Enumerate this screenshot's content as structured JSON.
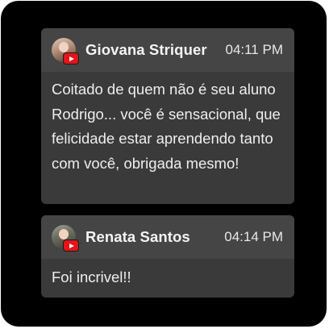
{
  "comments": [
    {
      "author": "Giovana Striquer",
      "time": "04:11 PM",
      "message": "Coitado de quem não é seu aluno Rodrigo... você é sensacional, que felicidade estar aprendendo tanto com você, obrigada mesmo!",
      "badge_icon": "youtube-icon"
    },
    {
      "author": "Renata Santos",
      "time": "04:14 PM",
      "message": "Foi incrivel!!",
      "badge_icon": "youtube-icon"
    }
  ],
  "colors": {
    "background": "#000000",
    "card": "#3a3a3a",
    "card_header": "#454545",
    "badge": "#e3141a",
    "text": "#f2f2f2"
  }
}
